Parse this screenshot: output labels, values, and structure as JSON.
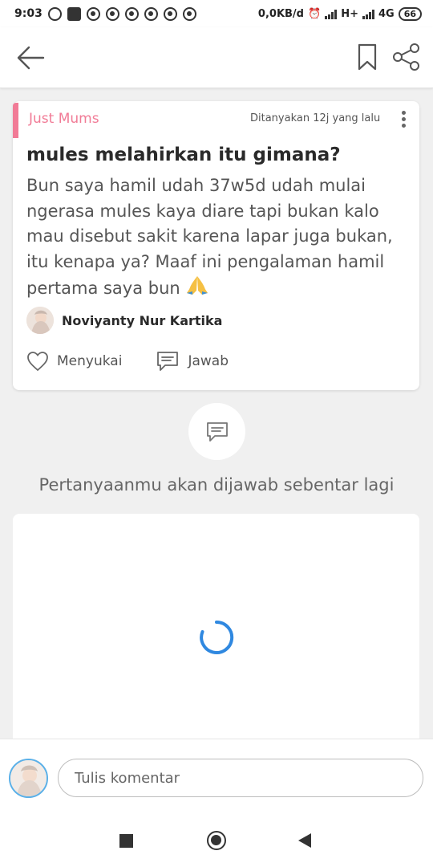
{
  "status_bar": {
    "time": "9:03",
    "speed": "0,0KB/d",
    "network_1": "H+",
    "network_2": "4G",
    "battery": "66"
  },
  "app_bar": {
    "back_icon": "arrow-left-icon",
    "bookmark_icon": "bookmark-icon",
    "share_icon": "share-icon"
  },
  "question": {
    "community": "Just Mums",
    "asked_time": "Ditanyakan 12j yang lalu",
    "title": "mules melahirkan itu gimana?",
    "body": "Bun saya hamil udah 37w5d udah mulai ngerasa mules kaya diare tapi bukan kalo mau disebut sakit karena lapar juga bukan, itu kenapa ya? Maaf ini pengalaman hamil pertama saya bun",
    "emoji": "🙏",
    "author": "Noviyanty Nur Kartika",
    "like_label": "Menyukai",
    "answer_label": "Jawab"
  },
  "waiting_text": "Pertanyaanmu akan dijawab sebentar lagi",
  "comment": {
    "placeholder": "Tulis komentar"
  },
  "colors": {
    "accent_pink": "#f17b96",
    "spinner_blue": "#2f88e0",
    "avatar_ring": "#5ab0e8"
  }
}
